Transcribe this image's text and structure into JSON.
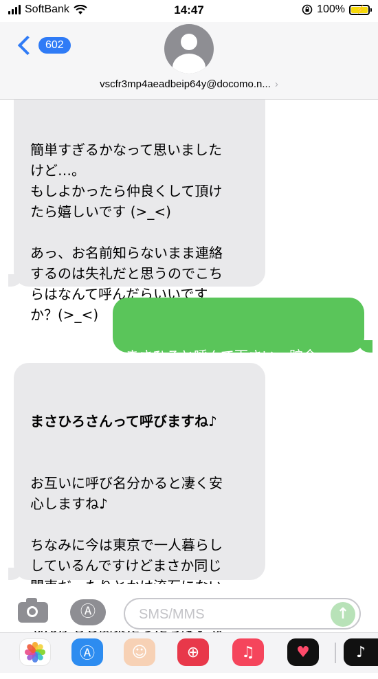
{
  "status_bar": {
    "carrier": "SoftBank",
    "time": "14:47",
    "battery": "100%",
    "battery_level": 1.0,
    "icons": [
      "signal-bars-icon",
      "wifi-icon",
      "orientation-lock-icon",
      "battery-charging-icon"
    ]
  },
  "header": {
    "back_count": "602",
    "contact": "vscfr3mp4aeadbeip64y@docomo.n...",
    "avatar_icon": "person-silhouette-icon"
  },
  "messages": [
    {
      "direction": "incoming",
      "text": "簡単すぎるかなって思いました\nけど…。\nもしよかったら仲良くして頂け\nたら嬉しいです (>_<)\n\nあっ、お名前知らないまま連絡\nするのは失礼だと思うのでこち\nらはなんて呼んだらいいです\nか？(>_<)"
    },
    {
      "direction": "outgoing",
      "text": "まさひろと呼んで下さい。貯金\nは結構ありますよ。"
    },
    {
      "direction": "incoming",
      "title": "まさひろさんって呼びますね♪",
      "text": "お互いに呼び名分かると凄く安\n心しますね♪\n\nちなみに今は東京で一人暮らし\nしているんですけどまさか同じ\n関東だったりとかは流石にない\nですよね…(笑)\nなんかもし関東だったら凄いな\nって!(^^)!"
    }
  ],
  "compose": {
    "placeholder": "SMS/MMS",
    "value": "",
    "camera_icon": "camera-icon",
    "apps_icon": "app-store-icon",
    "send_icon": "send-arrow-icon"
  },
  "app_drawer": {
    "apps": [
      "photos-icon",
      "app-store-icon",
      "memoji-icon",
      "image-search-icon",
      "music-icon",
      "heart-app-icon",
      "tiktok-icon"
    ]
  },
  "colors": {
    "ios_blue": "#2f7bf6",
    "incoming_bubble": "#e9e9eb",
    "outgoing_bubble": "#5ac55a",
    "battery_fill": "#f5d90a"
  }
}
